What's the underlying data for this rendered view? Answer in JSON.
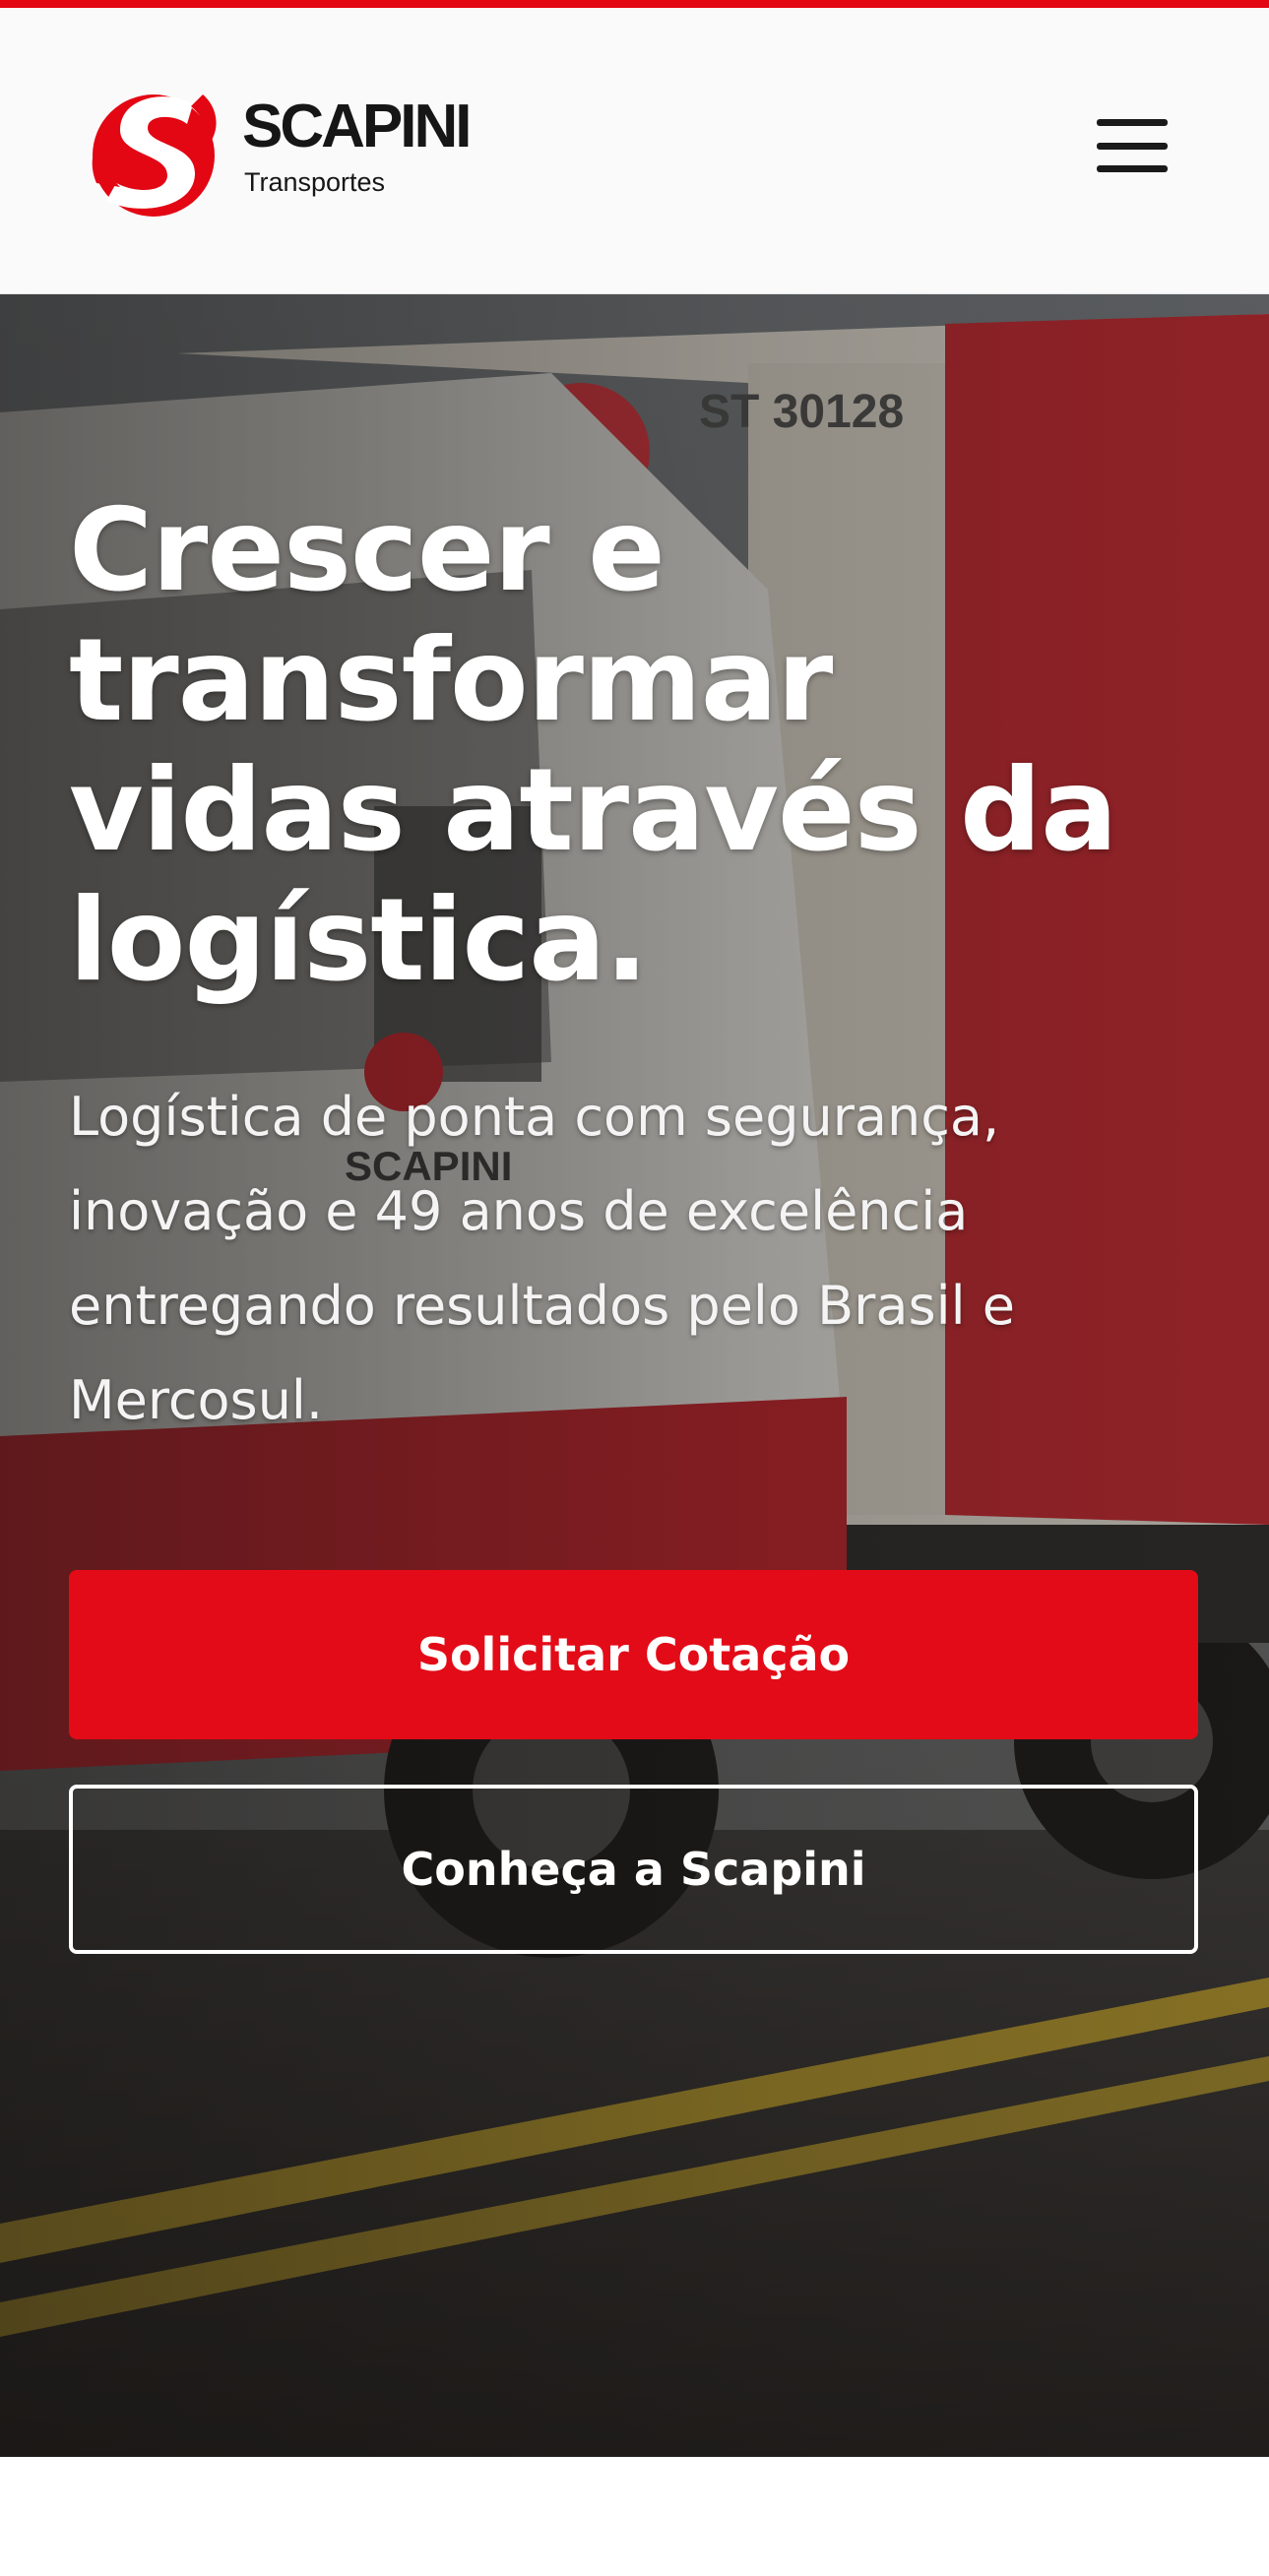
{
  "brand": {
    "name": "SCAPINI",
    "tagline": "Transportes",
    "accent_color": "#e30613",
    "logo_icon": "scapini-s-logo-icon"
  },
  "header": {
    "menu_icon": "hamburger-menu-icon"
  },
  "hero": {
    "title": "Crescer e transformar vidas através da logística.",
    "subtitle": "Logística de ponta com segurança, inovação e 49 anos de excelência entregando resultados pelo Brasil e Mercosul.",
    "primary_cta": "Solicitar Cotação",
    "secondary_cta": "Conheça a Scapini",
    "truck_plate_text": "ST 30128"
  },
  "floating": {
    "whatsapp_icon": "whatsapp-icon"
  }
}
